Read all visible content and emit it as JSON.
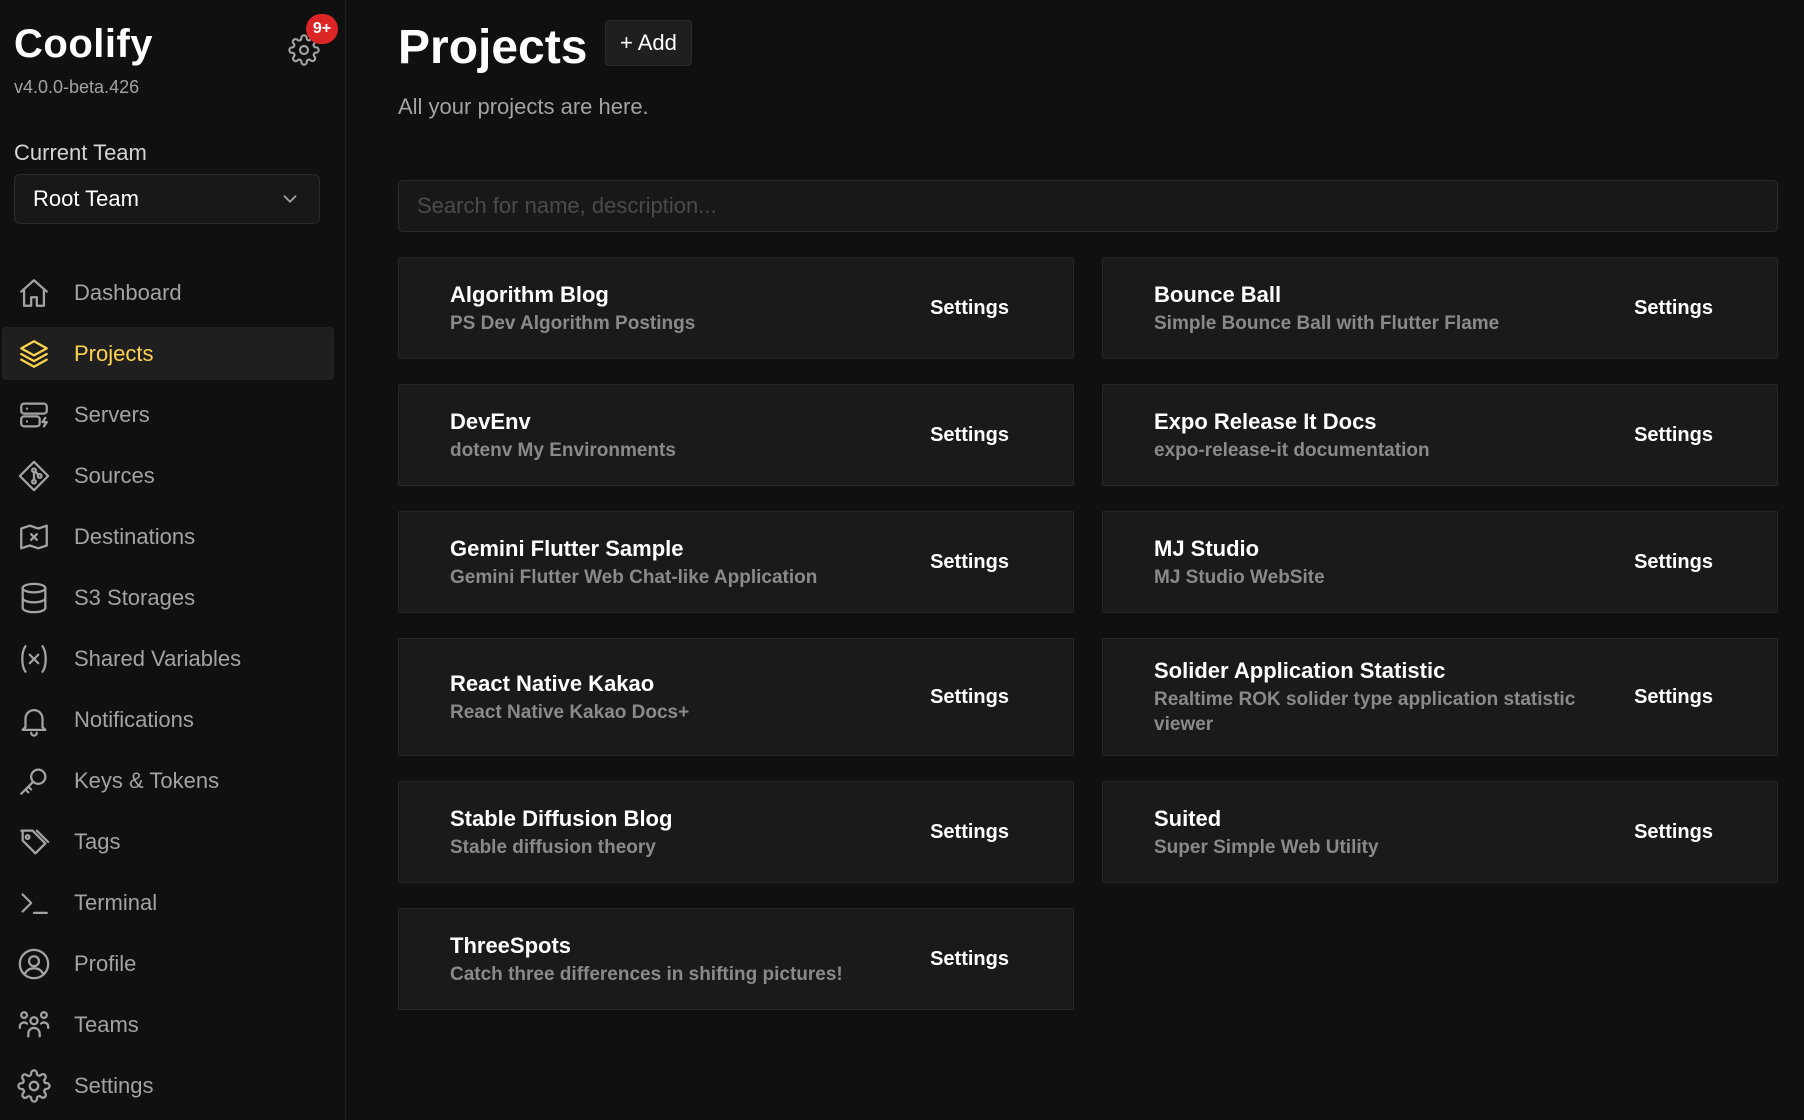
{
  "brand": {
    "name": "Coolify",
    "version": "v4.0.0-beta.426",
    "badge": "9+"
  },
  "team": {
    "label": "Current Team",
    "selected": "Root Team"
  },
  "nav": [
    {
      "label": "Dashboard",
      "icon": "home-icon",
      "active": false
    },
    {
      "label": "Projects",
      "icon": "layers-icon",
      "active": true
    },
    {
      "label": "Servers",
      "icon": "server-icon",
      "active": false
    },
    {
      "label": "Sources",
      "icon": "git-icon",
      "active": false
    },
    {
      "label": "Destinations",
      "icon": "map-icon",
      "active": false
    },
    {
      "label": "S3 Storages",
      "icon": "database-icon",
      "active": false
    },
    {
      "label": "Shared Variables",
      "icon": "variable-icon",
      "active": false
    },
    {
      "label": "Notifications",
      "icon": "bell-icon",
      "active": false
    },
    {
      "label": "Keys & Tokens",
      "icon": "key-icon",
      "active": false
    },
    {
      "label": "Tags",
      "icon": "tag-icon",
      "active": false
    },
    {
      "label": "Terminal",
      "icon": "terminal-icon",
      "active": false
    },
    {
      "label": "Profile",
      "icon": "user-icon",
      "active": false
    },
    {
      "label": "Teams",
      "icon": "users-icon",
      "active": false
    },
    {
      "label": "Settings",
      "icon": "gear-icon",
      "active": false
    }
  ],
  "page": {
    "title": "Projects",
    "add_label": "+ Add",
    "subtitle": "All your projects are here.",
    "search_placeholder": "Search for name, description..."
  },
  "projects": [
    {
      "title": "Algorithm Blog",
      "desc": "PS Dev Algorithm Postings",
      "settings": "Settings"
    },
    {
      "title": "Bounce Ball",
      "desc": "Simple Bounce Ball with Flutter Flame",
      "settings": "Settings"
    },
    {
      "title": "DevEnv",
      "desc": "dotenv My Environments",
      "settings": "Settings"
    },
    {
      "title": "Expo Release It Docs",
      "desc": "expo-release-it documentation",
      "settings": "Settings"
    },
    {
      "title": "Gemini Flutter Sample",
      "desc": "Gemini Flutter Web Chat-like Application",
      "settings": "Settings"
    },
    {
      "title": "MJ Studio",
      "desc": "MJ Studio WebSite",
      "settings": "Settings"
    },
    {
      "title": "React Native Kakao",
      "desc": "React Native Kakao Docs+",
      "settings": "Settings"
    },
    {
      "title": "Solider Application Statistic",
      "desc": "Realtime ROK solider type application statistic viewer",
      "settings": "Settings"
    },
    {
      "title": "Stable Diffusion Blog",
      "desc": "Stable diffusion theory",
      "settings": "Settings"
    },
    {
      "title": "Suited",
      "desc": "Super Simple Web Utility",
      "settings": "Settings"
    },
    {
      "title": "ThreeSpots",
      "desc": "Catch three differences in shifting pictures!",
      "settings": "Settings"
    }
  ],
  "colors": {
    "accent": "#fcd34d",
    "badge": "#dc2626",
    "background": "#101010",
    "card": "#1a1a1a"
  }
}
